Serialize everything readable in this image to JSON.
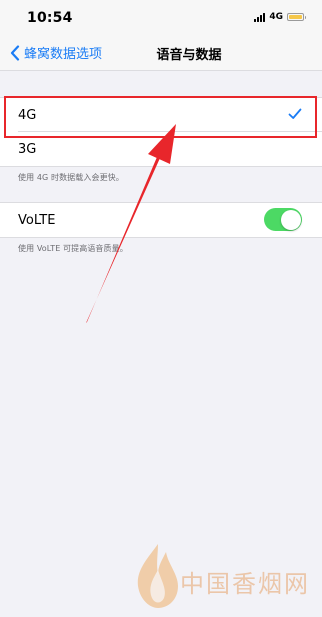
{
  "status_bar": {
    "time": "10:54",
    "network": "4G",
    "battery_color": "#f5c74a"
  },
  "nav": {
    "back_label": "蜂窝数据选项",
    "title": "语音与数据"
  },
  "options": [
    {
      "label": "4G",
      "selected": true
    },
    {
      "label": "3G",
      "selected": false
    }
  ],
  "options_note": "使用 4G 时数据载入会更快。",
  "volte": {
    "label": "VoLTE",
    "enabled": true,
    "note": "使用 VoLTE 可提高语音质量。"
  },
  "watermark": {
    "text": "中国香烟网"
  },
  "colors": {
    "accent": "#1a7cf5",
    "toggle_on": "#4cd964",
    "annotation": "#e8262b"
  }
}
